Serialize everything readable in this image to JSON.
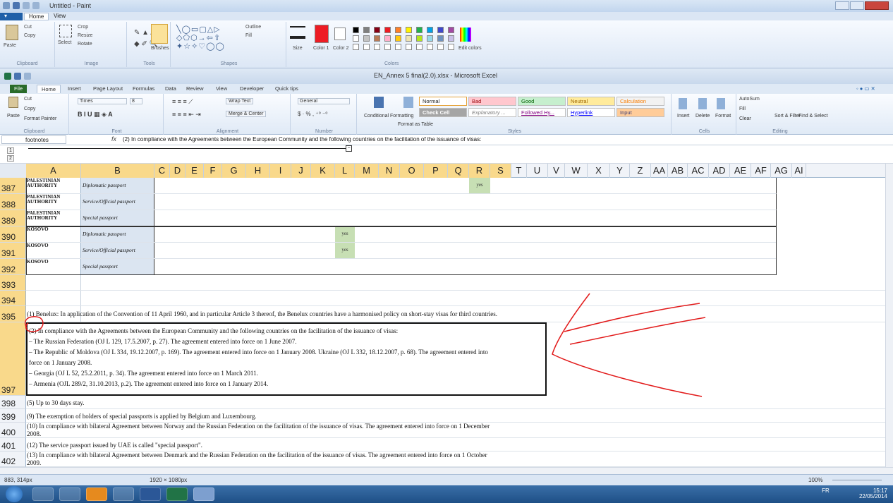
{
  "paint": {
    "title": "Untitled - Paint",
    "tabs": [
      "Home",
      "View"
    ],
    "groups": [
      "Clipboard",
      "Image",
      "Tools",
      "Shapes",
      "Colors"
    ],
    "buttons": {
      "paste": "Paste",
      "cut": "Cut",
      "copy": "Copy",
      "select": "Select",
      "crop": "Crop",
      "resize": "Resize",
      "rotate": "Rotate",
      "brushes": "Brushes",
      "outline": "Outline",
      "fill": "Fill",
      "size": "Size",
      "color1": "Color 1",
      "color2": "Color 2",
      "edit_colors": "Edit colors"
    },
    "palette": [
      "#000000",
      "#7f7f7f",
      "#880015",
      "#ed1c24",
      "#ff7f27",
      "#fff200",
      "#22b14c",
      "#00a2e8",
      "#3f48cc",
      "#a349a4",
      "#ffffff",
      "#c3c3c3",
      "#b97a57",
      "#ffaec9",
      "#ffc90e",
      "#efe4b0",
      "#b5e61d",
      "#99d9ea",
      "#7092be",
      "#c8bfe7"
    ],
    "status_pos": "883, 314px",
    "status_size": "1920 × 1080px",
    "zoom": "100%"
  },
  "excel": {
    "title": "EN_Annex 5 final(2.0).xlsx - Microsoft Excel",
    "tabs": [
      "File",
      "Home",
      "Insert",
      "Page Layout",
      "Formulas",
      "Data",
      "Review",
      "View",
      "Developer",
      "Quick tips"
    ],
    "clipboard": {
      "cut": "Cut",
      "copy": "Copy",
      "format_painter": "Format Painter",
      "paste": "Paste",
      "label": "Clipboard"
    },
    "font": {
      "name": "Times",
      "size": "8",
      "label": "Font"
    },
    "alignment": {
      "wrap": "Wrap Text",
      "merge": "Merge & Center",
      "label": "Alignment"
    },
    "number": {
      "format": "General",
      "label": "Number"
    },
    "styles": {
      "conditional": "Conditional Formatting",
      "format_table": "Format as Table",
      "normal": "Normal",
      "bad": "Bad",
      "good": "Good",
      "neutral": "Neutral",
      "calculation": "Calculation",
      "check_cell": "Check Cell",
      "explanatory": "Explanatory ...",
      "followed": "Followed Hy...",
      "hyperlink": "Hyperlink",
      "input": "Input",
      "label": "Styles"
    },
    "cells": {
      "insert": "Insert",
      "delete": "Delete",
      "format": "Format",
      "label": "Cells"
    },
    "editing": {
      "autosum": "AutoSum",
      "fill": "Fill",
      "clear": "Clear",
      "sort": "Sort & Filter",
      "find": "Find & Select",
      "label": "Editing"
    },
    "name_box": "footnotes",
    "formula": "(2) In compliance with the Agreements between the European Community and the following countries on the facilitation of the issuance of visas:",
    "outline_levels": [
      "1",
      "2"
    ],
    "columns": [
      "A",
      "B",
      "C",
      "D",
      "E",
      "F",
      "G",
      "H",
      "I",
      "J",
      "K",
      "L",
      "M",
      "N",
      "O",
      "P",
      "Q",
      "R",
      "S",
      "T",
      "U",
      "V",
      "W",
      "X",
      "Y",
      "Z",
      "AA",
      "AB",
      "AC",
      "AD",
      "AE",
      "AF",
      "AG",
      "AI"
    ],
    "rows": [
      {
        "num": "387",
        "a": "PALESTINIAN AUTHORITY",
        "b": "Diplomatic passport",
        "yes_col": "R",
        "yes": "yes"
      },
      {
        "num": "388",
        "a": "PALESTINIAN AUTHORITY",
        "b": "Service/Official passport"
      },
      {
        "num": "389",
        "a": "PALESTINIAN AUTHORITY",
        "b": "Special passport"
      },
      {
        "num": "390",
        "a": "KOSOVO",
        "b": "Diplomatic passport",
        "yes_col": "L",
        "yes": "yes"
      },
      {
        "num": "391",
        "a": "KOSOVO",
        "b": "Service/Official passport",
        "yes_col": "L",
        "yes": "yes"
      },
      {
        "num": "392",
        "a": "KOSOVO",
        "b": "Special passport"
      },
      {
        "num": "393"
      },
      {
        "num": "394"
      },
      {
        "num": "395",
        "note": "(1) Benelux: In application of the Convention of 11 April 1960, and in particular Article 3 thereof, the Benelux countries have a harmonised policy on short-stay visas for third countries."
      }
    ],
    "note397": [
      "(2) In compliance with the Agreements between the European Community and the following countries on the facilitation of the issuance of visas:",
      "– The Russian Federation (OJ L 129, 17.5.2007, p. 27). The agreement entered into force on 1 June 2007.",
      "– The Republic of Moldova (OJ L 334, 19.12.2007, p. 169). The agreement entered into force on 1 January 2008. Ukraine (OJ L 332, 18.12.2007, p. 68). The agreement entered into",
      "force on 1 January 2008.",
      "– Georgia (OJ L 52, 25.2.2011, p. 34). The agreement entered into force on 1 March 2011.",
      "– Armenia (OJL 289/2, 31.10.2013, p.2). The agreement entered into force on 1 January 2014."
    ],
    "row397": "397",
    "lower_rows": [
      {
        "num": "398",
        "lines": [
          "(5) Up to 30 days stay."
        ]
      },
      {
        "num": "399",
        "lines": [
          "(9) The exemption of holders of special passports is applied by Belgium and Luxembourg."
        ]
      },
      {
        "num": "400",
        "lines": [
          "(10) In compliance with bilateral Agreement between Norway and the Russian Federation on the facilitation of the issuance of visas. The agreement entered into force on 1 December",
          "2008."
        ]
      },
      {
        "num": "401",
        "lines": [
          "(12) The service passport issued by UAE is called \"special passport\"."
        ]
      },
      {
        "num": "402",
        "lines": [
          "(13) In compliance with bilateral Agreement between Denmark and the Russian Federation on the facilitation of the issuance of visas. The agreement entered into force on 1 October",
          "2009."
        ]
      }
    ]
  },
  "taskbar": {
    "lang": "FR",
    "time": "15:17",
    "date": "22/05/2014"
  },
  "colors": {
    "selected_header": "#f9d98b",
    "yes_fill": "#c7dfb4",
    "b_fill": "#dbe5f1",
    "annotation": "#e21b1b"
  }
}
